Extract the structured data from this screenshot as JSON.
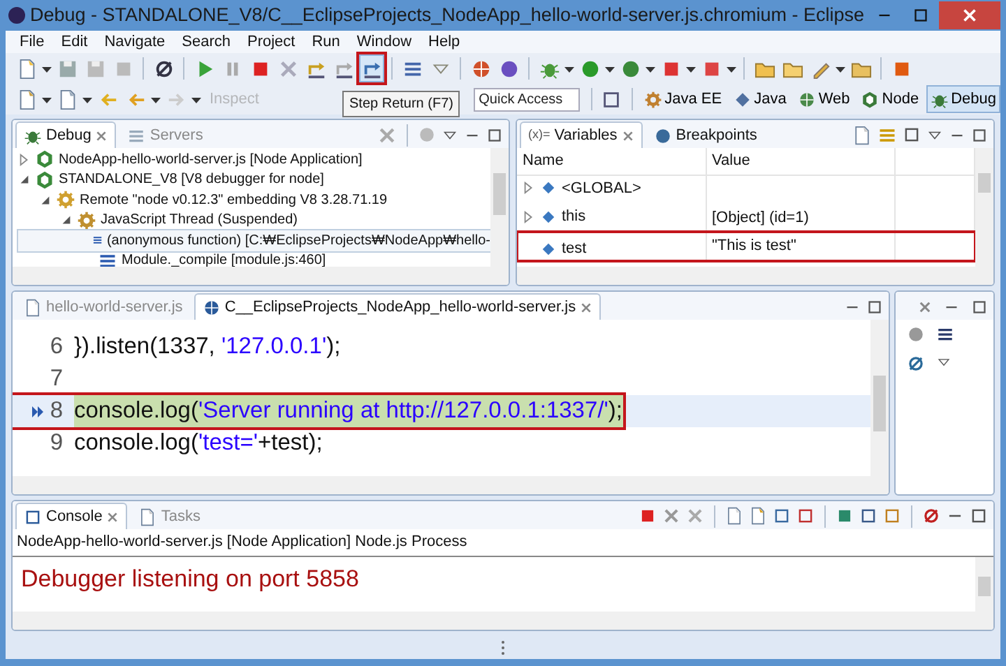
{
  "window": {
    "title": "Debug - STANDALONE_V8/C__EclipseProjects_NodeApp_hello-world-server.js.chromium - Eclipse"
  },
  "menu": [
    "File",
    "Edit",
    "Navigate",
    "Search",
    "Project",
    "Run",
    "Window",
    "Help"
  ],
  "toolbar": {
    "step_return": {
      "highlighted": true
    },
    "tooltip": "Step Return (F7)",
    "inspect": {
      "label": "Inspect",
      "disabled": true
    },
    "quick_access": {
      "placeholder": "Quick Access"
    },
    "perspectives": [
      {
        "label": "Java EE",
        "selected": false
      },
      {
        "label": "Java",
        "selected": false
      },
      {
        "label": "Web",
        "selected": false
      },
      {
        "label": "Node",
        "selected": false
      },
      {
        "label": "Debug",
        "selected": true
      }
    ]
  },
  "debug_view": {
    "tabs": [
      {
        "label": "Debug",
        "selected": true
      },
      {
        "label": "Servers",
        "selected": false
      }
    ],
    "tree": [
      {
        "label": "NodeApp-hello-world-server.js [Node Application]",
        "kind": "launch",
        "expanded": false
      },
      {
        "label": "STANDALONE_V8 [V8 debugger for node]",
        "kind": "launch",
        "expanded": true,
        "children": [
          {
            "label": "Remote \"node v0.12.3\" embedding V8 3.28.71.19",
            "kind": "target",
            "expanded": true,
            "children": [
              {
                "label": "JavaScript Thread (Suspended)",
                "kind": "thread",
                "expanded": true,
                "children": [
                  {
                    "label": "(anonymous function) [C:₩EclipseProjects₩NodeApp₩hello-",
                    "kind": "frame",
                    "selected": true
                  },
                  {
                    "label": "Module._compile [module.js:460]",
                    "kind": "frame",
                    "selected": false
                  }
                ]
              }
            ]
          }
        ]
      }
    ]
  },
  "variables_view": {
    "tabs": [
      {
        "label": "Variables",
        "glyph": "(x)=",
        "selected": true
      },
      {
        "label": "Breakpoints",
        "selected": false
      }
    ],
    "columns": [
      "Name",
      "Value"
    ],
    "rows": [
      {
        "name": "<GLOBAL>",
        "expandable": true,
        "highlighted": false
      },
      {
        "name": "this",
        "value": "[Object]  (id=1)",
        "expandable": true,
        "highlighted": false
      },
      {
        "name": "test",
        "value": "\"This is test\"",
        "expandable": false,
        "highlighted": true
      }
    ]
  },
  "editor": {
    "tabs": [
      {
        "label": "hello-world-server.js",
        "selected": false
      },
      {
        "label": "C__EclipseProjects_NodeApp_hello-world-server.js",
        "selected": true
      }
    ],
    "lines": [
      {
        "number": "6",
        "current": false,
        "highlighted": false,
        "segments": [
          {
            "text": "}).listen(1337, ",
            "kind": "plain"
          },
          {
            "text": "'127.0.0.1'",
            "kind": "string"
          },
          {
            "text": ");",
            "kind": "plain"
          }
        ]
      },
      {
        "number": "7",
        "current": false,
        "highlighted": false
      },
      {
        "number": "8",
        "current": true,
        "highlighted": true,
        "segments": [
          {
            "text": "console.log(",
            "kind": "plain"
          },
          {
            "text": "'Server running at http://127.0.0.1:1337/'",
            "kind": "string"
          },
          {
            "text": ");",
            "kind": "plain"
          }
        ]
      },
      {
        "number": "9",
        "current": false,
        "highlighted": false,
        "segments": [
          {
            "text": "console.log(",
            "kind": "plain"
          },
          {
            "text": "'test='",
            "kind": "string"
          },
          {
            "text": "+test);",
            "kind": "plain"
          }
        ]
      }
    ]
  },
  "console_view": {
    "tabs": [
      {
        "label": "Console",
        "selected": true
      },
      {
        "label": "Tasks",
        "selected": false
      }
    ],
    "process": "NodeApp-hello-world-server.js [Node Application] Node.js Process",
    "output": [
      {
        "text": "Debugger listening on port 5858",
        "kind": "stderr"
      }
    ]
  }
}
